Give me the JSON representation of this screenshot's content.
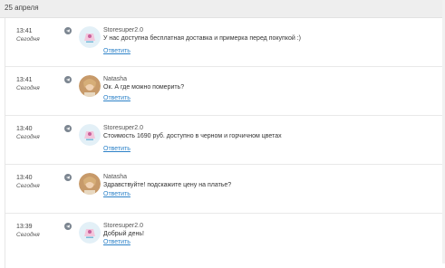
{
  "date_header": "25 апреля",
  "messages": [
    {
      "time": "13:41",
      "day": "Сегодня",
      "name": "Storesuper2.0",
      "text": "У нас доступна бесплатная доставка и примерка перед покупкой :)",
      "reply": "Ответить",
      "avatar": "store-avatar-icon"
    },
    {
      "time": "13:41",
      "day": "Сегодня",
      "name": "Natasha",
      "text": "Ок. А где можно померить?",
      "reply": "Ответить",
      "avatar": "user-photo-avatar"
    },
    {
      "time": "13:40",
      "day": "Сегодня",
      "name": "Storesuper2.0",
      "text": "Стоимость 1690 руб. доступно в черном и горчичном цветах",
      "reply": "Ответить",
      "avatar": "store-avatar-icon"
    },
    {
      "time": "13:40",
      "day": "Сегодня",
      "name": "Natasha",
      "text": "Здравствуйте! подскажите цену на платье?",
      "reply": "Ответить",
      "avatar": "user-photo-avatar"
    },
    {
      "time": "13:39",
      "day": "Сегодня",
      "name": "Storesuper2.0",
      "text": "Добрый день!",
      "reply": "Ответить",
      "avatar": "store-avatar-icon"
    }
  ],
  "colors": {
    "link": "#2d82c8",
    "header_bg": "#eeeeee"
  }
}
